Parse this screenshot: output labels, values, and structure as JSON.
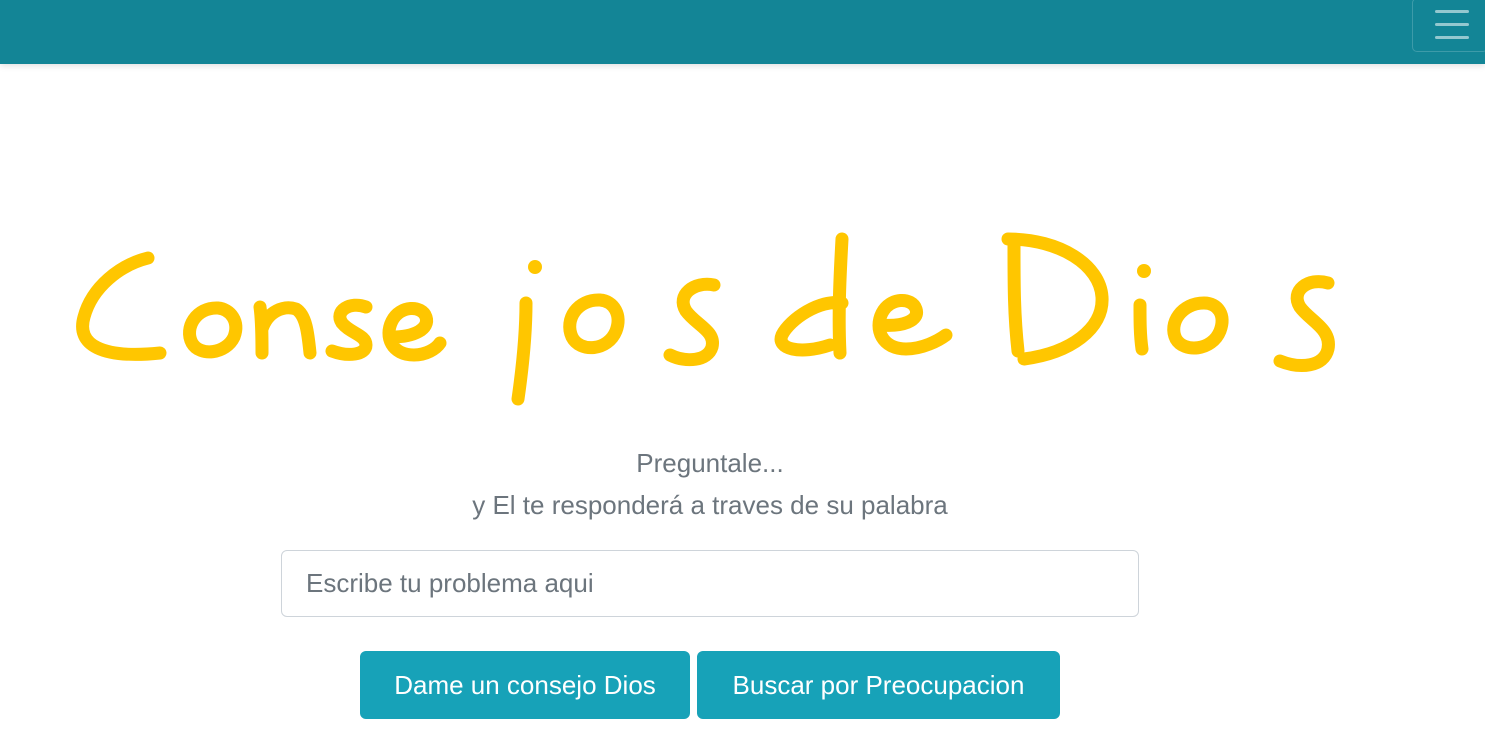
{
  "navbar": {
    "toggler_icon": "hamburger-menu-icon",
    "background": "#138596"
  },
  "logo": {
    "text": "Consejos de Dios",
    "color": "#ffc600"
  },
  "hero": {
    "line1": "Preguntale...",
    "line2": "y El te responderá a traves de su palabra"
  },
  "search": {
    "value": "",
    "placeholder": "Escribe tu problema aqui"
  },
  "buttons": {
    "advice_label": "Dame un consejo Dios",
    "search_label": "Buscar por Preocupacion",
    "color": "#17a2b8"
  }
}
